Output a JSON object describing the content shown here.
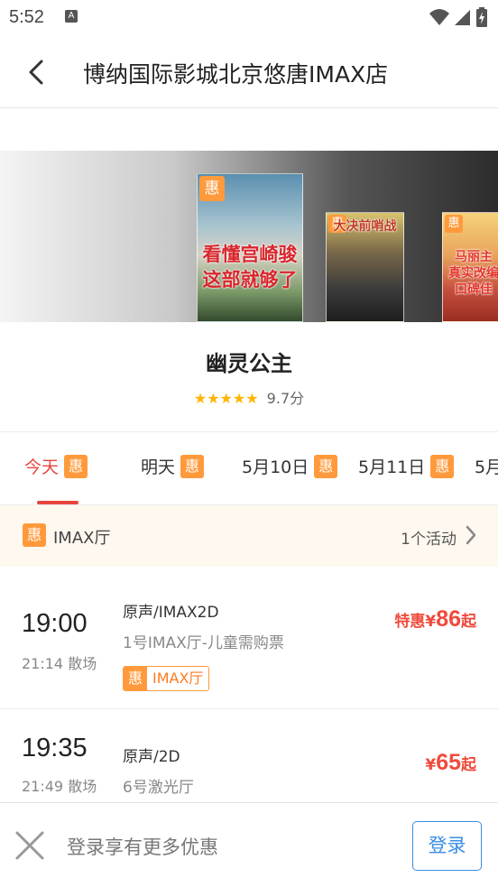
{
  "status_bar": {
    "time": "5:52",
    "notification_icon": "A"
  },
  "header": {
    "title": "博纳国际影城北京悠唐IMAX店"
  },
  "banner": {
    "posters": [
      {
        "tag": "惠",
        "caption_line1": "看懂宫崎骏",
        "caption_line2": "这部就够了"
      },
      {
        "tag": "惠",
        "caption_line1": "大决前哨战"
      },
      {
        "tag": "惠",
        "caption_line1": "马丽主",
        "caption_line2": "真实改编",
        "caption_line3": "口碑佳"
      }
    ]
  },
  "movie": {
    "title": "幽灵公主",
    "stars": "★★★★★",
    "score": "9.7分"
  },
  "date_tabs": [
    {
      "label": "今天",
      "tag": "惠",
      "active": true
    },
    {
      "label": "明天",
      "tag": "惠",
      "active": false
    },
    {
      "label": "5月10日",
      "tag": "惠",
      "active": false
    },
    {
      "label": "5月11日",
      "tag": "惠",
      "active": false
    },
    {
      "label": "5月",
      "tag": "",
      "active": false
    }
  ],
  "hall_bar": {
    "tag": "惠",
    "hall": "IMAX厅",
    "activity": "1个活动"
  },
  "showtimes": [
    {
      "start": "19:00",
      "end": "21:14 散场",
      "lang": "原声/IMAX2D",
      "hall": "1号IMAX厅-儿童需购票",
      "price_prefix": "特惠¥",
      "price": "86",
      "price_suffix": "起",
      "badge_tag": "惠",
      "badge_text": "IMAX厅"
    },
    {
      "start": "19:35",
      "end": "21:49 散场",
      "lang": "原声/2D",
      "hall": "6号激光厅",
      "price_prefix": "¥",
      "price": "65",
      "price_suffix": "起"
    }
  ],
  "bottom_bar": {
    "tip": "登录享有更多优惠",
    "login_label": "登录"
  },
  "colors": {
    "accent": "#e8453c",
    "promo": "#ff9a3c",
    "link": "#3a8ee6"
  }
}
